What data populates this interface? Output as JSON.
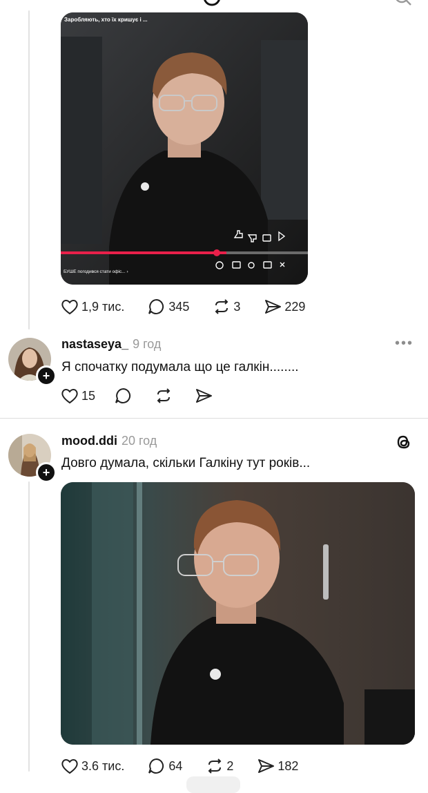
{
  "post1": {
    "video_caption": "Заробляють, хто їх кришує і ...",
    "video_bottom_text": "БУШЕ погодився стати офіс... ›",
    "stats": {
      "likes": "1,9 тис.",
      "replies": "345",
      "reposts": "3",
      "shares": "229"
    }
  },
  "reply1": {
    "username": "nastaseya_",
    "time": "9 год",
    "text": "Я спочатку подумала що це галкін........",
    "stats": {
      "likes": "15"
    }
  },
  "post2": {
    "username": "mood.ddi",
    "time": "20 год",
    "text": "Довго думала, скільки Галкіну тут років...",
    "stats": {
      "likes": "3.6 тис.",
      "replies": "64",
      "reposts": "2",
      "shares": "182"
    }
  },
  "colors": {
    "text": "#111111",
    "muted": "#999999",
    "divider": "#dcdcdc",
    "video_progress": "#e8204a"
  }
}
